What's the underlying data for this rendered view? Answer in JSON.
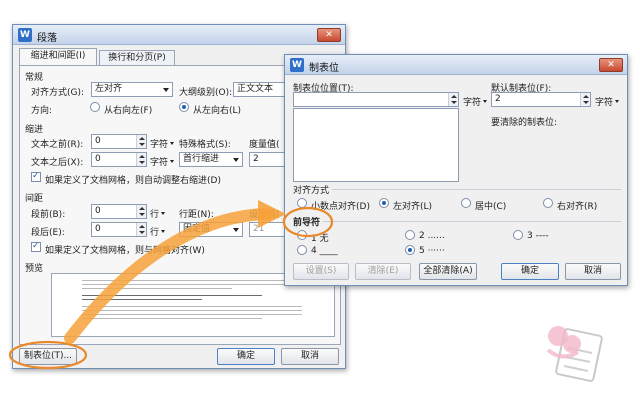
{
  "paragraph_dialog": {
    "title": "段落",
    "tabs": [
      "缩进和间距(I)",
      "换行和分页(P)"
    ],
    "general_label": "常规",
    "align_label": "对齐方式(G):",
    "align_value": "左对齐",
    "outline_label": "大纲级别(O):",
    "outline_value": "正文文本",
    "direction_label": "方向:",
    "rtl_label": "从右向左(F)",
    "ltr_label": "从左向右(L)",
    "indent_label": "缩进",
    "before_text_label": "文本之前(R):",
    "before_text_value": "0",
    "after_text_label": "文本之后(X):",
    "after_text_value": "0",
    "unit_char": "字符",
    "special_label": "特殊格式(S):",
    "special_value": "首行缩进",
    "measure_label": "度量值(",
    "measure_value": "2",
    "grid_indent_check": "如果定义了文档网格，则自动调整右缩进(D)",
    "spacing_label": "间距",
    "before_para_label": "段前(B):",
    "before_para_value": "0",
    "after_para_label": "段后(E):",
    "after_para_value": "0",
    "unit_line": "行",
    "line_spacing_label": "行距(N):",
    "line_spacing_value": "固定值",
    "set_value_label": "设置值(",
    "set_value_value": "21",
    "grid_align_check": "如果定义了文档网格，则与网格对齐(W)",
    "preview_label": "预览",
    "tab_button": "制表位(T)...",
    "ok_button": "确定",
    "cancel_button": "取消"
  },
  "tabs_dialog": {
    "title": "制表位",
    "tab_pos_label": "制表位位置(T):",
    "tab_pos_unit": "字符",
    "default_tab_label": "默认制表位(F):",
    "default_tab_value": "2",
    "default_tab_unit": "字符",
    "clear_label": "要清除的制表位:",
    "alignment_label": "对齐方式",
    "align_options": [
      "小数点对齐(D)",
      "左对齐(L)",
      "居中(C)",
      "右对齐(R)"
    ],
    "leader_label": "前导符",
    "leader_options": [
      "1 无",
      "2 ......",
      "3 ----",
      "4 ____",
      "5 ······"
    ],
    "set_button": "设置(S)",
    "clear_button": "清除(E)",
    "clear_all_button": "全部清除(A)",
    "ok_button": "确定",
    "cancel_button": "取消"
  },
  "colors": {
    "accent": "#f7a23b",
    "highlight": "#e9892a",
    "title_icon": "#2f6fc7"
  }
}
